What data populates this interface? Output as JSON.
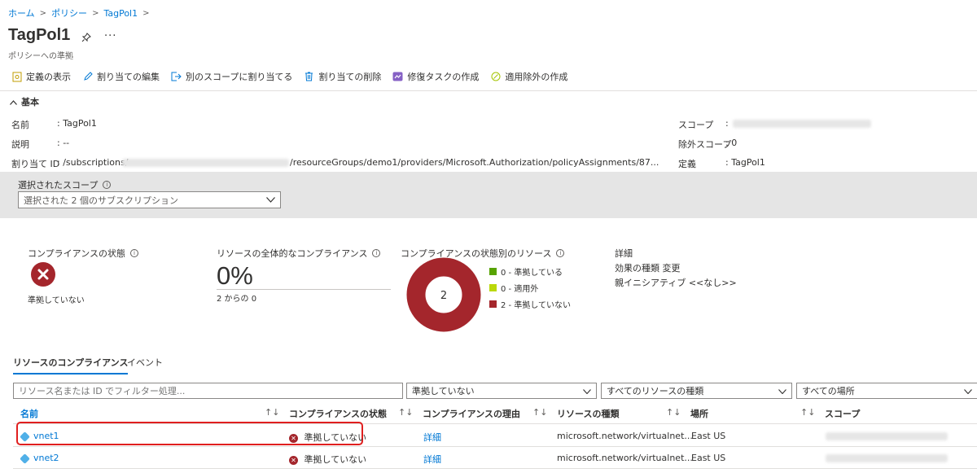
{
  "breadcrumb": [
    "ホーム",
    "ポリシー",
    "TagPol1"
  ],
  "page": {
    "title": "TagPol1",
    "subtitle": "ポリシーへの準拠"
  },
  "toolbar": {
    "view_definition": "定義の表示",
    "edit_assignment": "割り当ての編集",
    "assign_other_scope": "別のスコープに割り当てる",
    "delete_assignment": "割り当ての削除",
    "create_remediation": "修復タスクの作成",
    "create_exemption": "適用除外の作成"
  },
  "essentials": {
    "header": "基本",
    "name_label": "名前",
    "name_value": ": TagPol1",
    "desc_label": "説明",
    "desc_value": ": --",
    "assignment_id_label": "割り当て ID",
    "assignment_id_prefix": ": /subscriptions/",
    "assignment_id_suffix": "/resourceGroups/demo1/providers/Microsoft.Authorization/policyAssignments/87...",
    "scope_label": "スコープ",
    "scope_value": ":",
    "excluded_scope_label": "除外スコープ",
    "excluded_scope_value": ": 0",
    "definition_label": "定義",
    "definition_value": ": TagPol1"
  },
  "scope_filter": {
    "label": "選択されたスコープ",
    "value": "選択された 2 個のサブスクリプション"
  },
  "summary": {
    "state_title": "コンプライアンスの状態",
    "state_value": "準拠していない",
    "overall_title": "リソースの全体的なコンプライアンス",
    "overall_percent": "0%",
    "overall_sub": "2 からの 0",
    "by_state_title": "コンプライアンスの状態別のリソース",
    "donut_total": "2",
    "legend": [
      {
        "label": "0 - 準拠している",
        "value": 0,
        "color": "#57a300"
      },
      {
        "label": "0 - 適用外",
        "value": 0,
        "color": "#bad80a"
      },
      {
        "label": "2 - 準拠していない",
        "value": 2,
        "color": "#a4262c"
      }
    ],
    "details_title": "詳細",
    "effect_type": "効果の種類  変更",
    "parent_initiative": "親イニシアティブ  <<なし>>"
  },
  "tabs": {
    "resource_compliance": "リソースのコンプライアンス",
    "events": "イベント"
  },
  "filters": {
    "search_placeholder": "リソース名または ID でフィルター処理...",
    "state": "準拠していない",
    "resource_type": "すべてのリソースの種類",
    "location": "すべての場所"
  },
  "table": {
    "headers": {
      "name": "名前",
      "state": "コンプライアンスの状態",
      "reason": "コンプライアンスの理由",
      "type": "リソースの種類",
      "location": "場所",
      "scope": "スコープ"
    },
    "sort_glyph": "↑↓",
    "rows": [
      {
        "name": "vnet1",
        "state": "準拠していない",
        "reason": "詳細",
        "type": "microsoft.network/virtualnet...",
        "location": "East US"
      },
      {
        "name": "vnet2",
        "state": "準拠していない",
        "reason": "詳細",
        "type": "microsoft.network/virtualnet...",
        "location": "East US"
      }
    ]
  },
  "colors": {
    "accent": "#0078d4",
    "non_compliant": "#a4262c",
    "highlight_border": "#e01f1f"
  }
}
